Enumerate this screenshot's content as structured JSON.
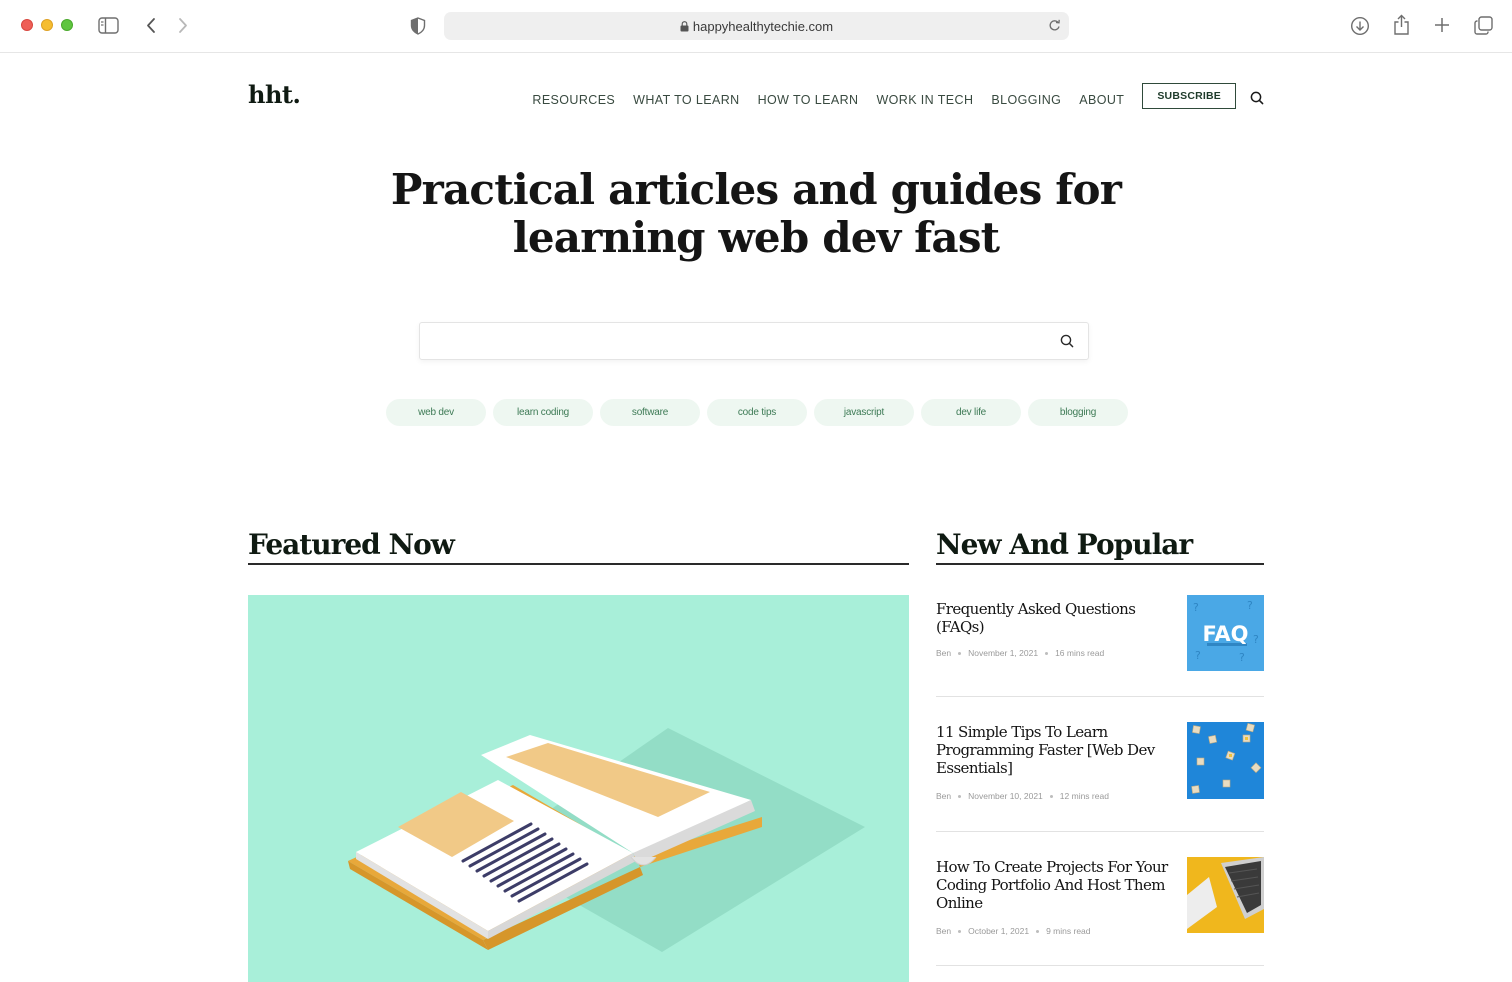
{
  "browser": {
    "url": "happyhealthytechie.com"
  },
  "site": {
    "logo": "hht.",
    "nav": [
      "RESOURCES",
      "WHAT TO LEARN",
      "HOW TO LEARN",
      "WORK IN TECH",
      "BLOGGING",
      "ABOUT"
    ],
    "subscribe_label": "SUBSCRIBE"
  },
  "hero": {
    "line1": "Practical articles and guides for",
    "line2": "learning web dev fast"
  },
  "search": {
    "value": ""
  },
  "tags": [
    "web dev",
    "learn coding",
    "software",
    "code tips",
    "javascript",
    "dev life",
    "blogging"
  ],
  "featured": {
    "heading": "Featured Now"
  },
  "popular": {
    "heading": "New And Popular",
    "posts": [
      {
        "title": "Frequently Asked Questions (FAQs)",
        "author": "Ben",
        "date": "November 1, 2021",
        "read": "16 mins read",
        "thumb_text": "FAQ"
      },
      {
        "title": "11 Simple Tips To Learn Programming Faster [Web Dev Essentials]",
        "author": "Ben",
        "date": "November 10, 2021",
        "read": "12 mins read"
      },
      {
        "title": "How To Create Projects For Your Coding Portfolio And Host Them Online",
        "author": "Ben",
        "date": "October 1, 2021",
        "read": "9 mins read"
      }
    ]
  },
  "colors": {
    "featured_bg": "#a8efd9",
    "tag_bg": "#eef7f1",
    "tag_text": "#3d7a55",
    "accent": "#1f3b2b"
  }
}
